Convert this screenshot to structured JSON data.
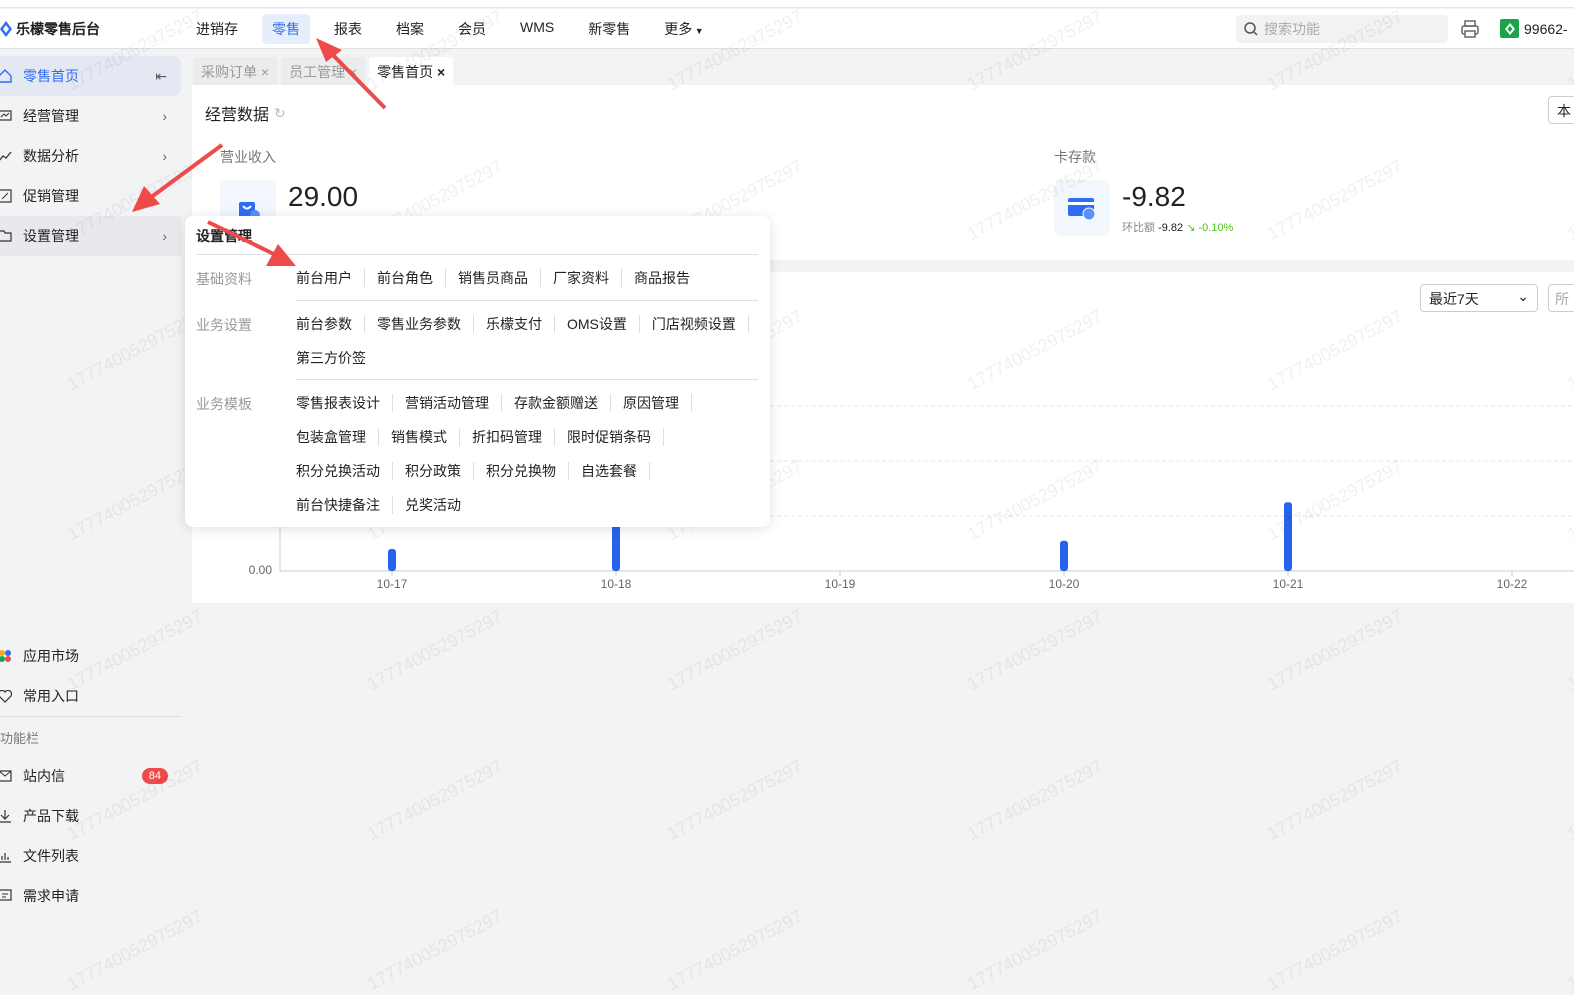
{
  "app": {
    "title": "乐檬零售后台"
  },
  "nav": {
    "items": [
      "进销存",
      "零售",
      "报表",
      "档案",
      "会员",
      "WMS",
      "新零售",
      "更多"
    ],
    "active": 1
  },
  "search": {
    "placeholder": "搜索功能"
  },
  "user": {
    "id": "99662-"
  },
  "sidebar": {
    "items": [
      {
        "label": "零售首页",
        "icon": "home-icon"
      },
      {
        "label": "经营管理",
        "icon": "monitor-icon"
      },
      {
        "label": "数据分析",
        "icon": "chart-line-icon"
      },
      {
        "label": "促销管理",
        "icon": "promo-icon"
      },
      {
        "label": "设置管理",
        "icon": "folder-icon"
      }
    ],
    "bottom": [
      {
        "label": "应用市场",
        "icon": "app-market-icon"
      },
      {
        "label": "常用入口",
        "icon": "heart-icon"
      }
    ],
    "section_label": "功能栏",
    "tools": [
      {
        "label": "站内信",
        "icon": "message-icon",
        "count": "84"
      },
      {
        "label": "产品下载",
        "icon": "download-icon"
      },
      {
        "label": "文件列表",
        "icon": "file-list-icon"
      },
      {
        "label": "需求申请",
        "icon": "request-icon"
      }
    ]
  },
  "tabs": [
    {
      "label": "采购订单"
    },
    {
      "label": "员工管理"
    },
    {
      "label": "零售首页"
    }
  ],
  "overview": {
    "title": "经营数据",
    "right_btn": "本",
    "stats": [
      {
        "label": "营业收入",
        "value": "29.00"
      },
      {
        "label": "卡存款",
        "value": "-9.82",
        "compare_label": "环比额",
        "compare_value": "-9.82",
        "change": "-0.10%"
      }
    ]
  },
  "chart_filter": {
    "range": "最近7天",
    "other": "所"
  },
  "chart_data": {
    "type": "bar",
    "categories": [
      "10-17",
      "10-18",
      "10-19",
      "10-20",
      "10-21",
      "10-22"
    ],
    "values": [
      0.4,
      1.6,
      0,
      0.55,
      1.25,
      0
    ],
    "ytick_labels": [
      "0.00"
    ],
    "ylim": [
      0,
      3
    ],
    "color": "#2563eb",
    "grid": true
  },
  "popup": {
    "title": "设置管理",
    "groups": [
      {
        "label": "基础资料",
        "links": [
          "前台用户",
          "前台角色",
          "销售员商品",
          "厂家资料",
          "商品报告"
        ]
      },
      {
        "label": "业务设置",
        "links": [
          "前台参数",
          "零售业务参数",
          "乐檬支付",
          "OMS设置",
          "门店视频设置",
          "第三方价签"
        ]
      },
      {
        "label": "业务模板",
        "links": [
          "零售报表设计",
          "营销活动管理",
          "存款金额赠送",
          "原因管理",
          "包装盒管理",
          "销售模式",
          "折扣码管理",
          "限时促销条码",
          "积分兑换活动",
          "积分政策",
          "积分兑换物",
          "自选套餐",
          "前台快捷备注",
          "兑奖活动"
        ]
      }
    ]
  },
  "watermark": "177740052975297",
  "colors": {
    "accent": "#2f6cf5",
    "arrow": "#ef4a4a",
    "badge": "#f04a4a",
    "down": "#52c41a"
  }
}
